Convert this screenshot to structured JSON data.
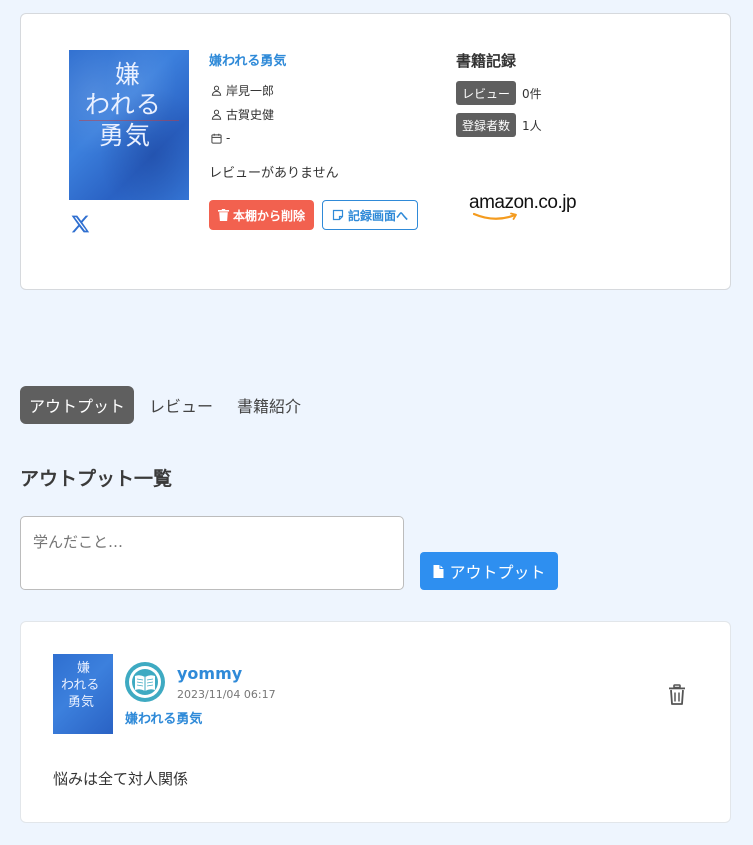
{
  "book": {
    "title": "嫌われる勇気",
    "authors": [
      "岸見一郎",
      "古賀史健"
    ],
    "date": "-",
    "no_review_text": "レビューがありません",
    "delete_button": "本棚から削除",
    "record_button": "記録画面へ",
    "cover_lines": [
      "嫌",
      "われる",
      "勇気"
    ]
  },
  "records": {
    "title": "書籍記録",
    "review_tag": "レビュー",
    "review_count": "0件",
    "registrants_tag": "登録者数",
    "registrants_count": "1人",
    "store_logo_text": "amazon.co.jp"
  },
  "tabs": [
    {
      "label": "アウトプット",
      "active": true
    },
    {
      "label": "レビュー",
      "active": false
    },
    {
      "label": "書籍紹介",
      "active": false
    }
  ],
  "outputs_section": {
    "title": "アウトプット一覧",
    "input_placeholder": "学んだこと…",
    "submit_label": "アウトプット"
  },
  "output_item": {
    "username": "yommy",
    "timestamp": "2023/11/04 06:17",
    "book_title": "嫌われる勇気",
    "text": "悩みは全て対人関係"
  },
  "colors": {
    "accent": "#2f8ad8",
    "danger": "#f2614f",
    "primary_button": "#2e8ff0",
    "tag": "#5f5f5f",
    "background": "#eef5fe"
  },
  "icons": [
    "x-logo-icon",
    "user-icon",
    "calendar-icon",
    "trash-icon",
    "note-icon",
    "file-icon",
    "book-avatar-icon"
  ]
}
